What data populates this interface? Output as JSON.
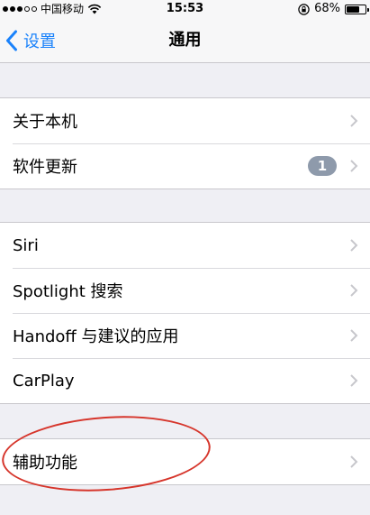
{
  "status_bar": {
    "carrier": "中国移动",
    "time": "15:53",
    "battery_percent": "68%",
    "battery_level": 0.68,
    "icons": [
      "signal-dots-icon",
      "wifi-icon",
      "orientation-lock-icon",
      "battery-icon"
    ]
  },
  "nav": {
    "back_label": "设置",
    "title": "通用"
  },
  "groups": [
    {
      "items": [
        {
          "label": "关于本机"
        },
        {
          "label": "软件更新",
          "badge": "1"
        }
      ]
    },
    {
      "items": [
        {
          "label": "Siri"
        },
        {
          "label": "Spotlight 搜索"
        },
        {
          "label": "Handoff 与建议的应用"
        },
        {
          "label": "CarPlay"
        }
      ]
    },
    {
      "items": [
        {
          "label": "辅助功能"
        }
      ]
    }
  ],
  "colors": {
    "accent": "#1a82fb",
    "background": "#efeff4",
    "badge": "#8e9aab",
    "annotation": "#d6352b"
  }
}
